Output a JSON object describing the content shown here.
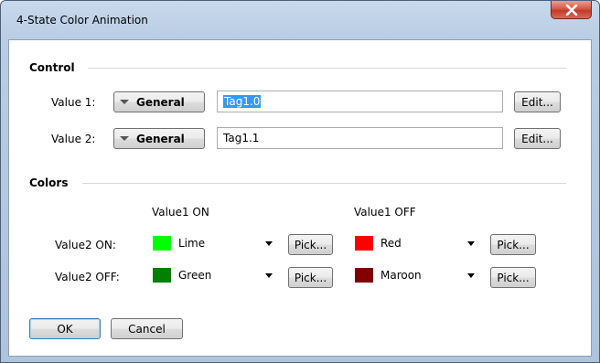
{
  "window": {
    "title": "4-State Color Animation",
    "close_glyph": "X"
  },
  "control": {
    "section_label": "Control",
    "rows": [
      {
        "label": "Value 1:",
        "type_label": "General",
        "tag_value": "Tag1.0",
        "edit_label": "Edit..."
      },
      {
        "label": "Value 2:",
        "type_label": "General",
        "tag_value": "Tag1.1",
        "edit_label": "Edit..."
      }
    ]
  },
  "colors": {
    "section_label": "Colors",
    "col_on": "Value1 ON",
    "col_off": "Value1 OFF",
    "rows": [
      {
        "label": "Value2 ON:",
        "on_color_name": "Lime",
        "on_color_hex": "#00ff00",
        "off_color_name": "Red",
        "off_color_hex": "#ff0000"
      },
      {
        "label": "Value2 OFF:",
        "on_color_name": "Green",
        "on_color_hex": "#008000",
        "off_color_name": "Maroon",
        "off_color_hex": "#800000"
      }
    ],
    "pick_label": "Pick..."
  },
  "footer": {
    "ok_label": "OK",
    "cancel_label": "Cancel"
  }
}
